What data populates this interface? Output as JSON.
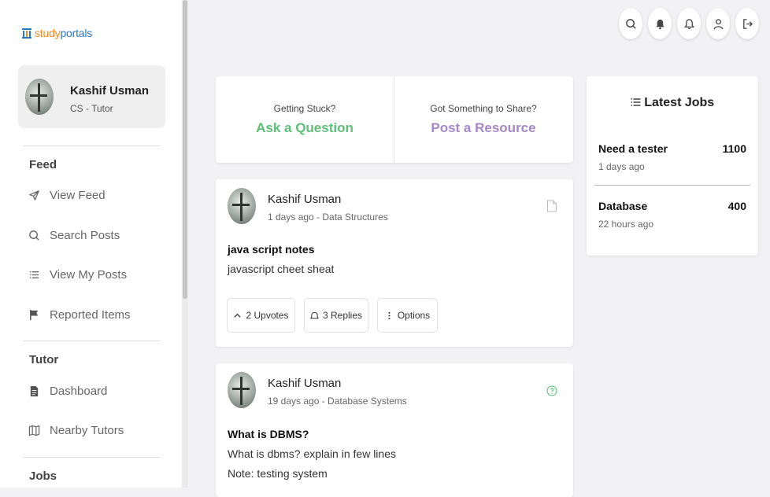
{
  "brand": {
    "logo_part1": "study",
    "logo_part2": "portals"
  },
  "profile": {
    "name": "Kashif Usman",
    "role": "CS - Tutor"
  },
  "sidebar": {
    "sections": [
      {
        "title": "Feed",
        "items": [
          {
            "label": "View Feed",
            "icon": "send-icon"
          },
          {
            "label": "Search Posts",
            "icon": "search-icon"
          },
          {
            "label": "View My Posts",
            "icon": "list-icon"
          },
          {
            "label": "Reported Items",
            "icon": "flag-icon"
          }
        ]
      },
      {
        "title": "Tutor",
        "items": [
          {
            "label": "Dashboard",
            "icon": "file-icon"
          },
          {
            "label": "Nearby Tutors",
            "icon": "map-icon"
          }
        ]
      },
      {
        "title": "Jobs",
        "items": []
      }
    ]
  },
  "topbar": {
    "icons": [
      "search-icon",
      "bell-icon",
      "notification-icon",
      "user-icon",
      "logout-icon"
    ]
  },
  "ask": {
    "question_prompt": "Getting Stuck?",
    "question_action": "Ask a Question",
    "resource_prompt": "Got Something to Share?",
    "resource_action": "Post a Resource"
  },
  "posts": [
    {
      "author": "Kashif Usman",
      "meta": "1 days ago - Data Structures",
      "title": "java script notes",
      "body": "javascript cheet sheat",
      "type_icon": "document-icon",
      "upvotes": "2 Upvotes",
      "replies": "3 Replies",
      "options": "Options"
    },
    {
      "author": "Kashif Usman",
      "meta": "19 days ago - Database Systems",
      "title": "What is DBMS?",
      "body": "What is dbms? explain in few lines",
      "note": "Note: testing system",
      "type_icon": "question-icon"
    }
  ],
  "jobs": {
    "title": "Latest Jobs",
    "items": [
      {
        "name": "Need a tester",
        "price": "1100",
        "time": "1 days ago"
      },
      {
        "name": "Database",
        "price": "400",
        "time": "22 hours ago"
      }
    ]
  },
  "colors": {
    "accent_green": "#5cbf76",
    "accent_purple": "#a587c7",
    "logo_orange": "#f08a24",
    "logo_blue": "#2b79c2"
  }
}
